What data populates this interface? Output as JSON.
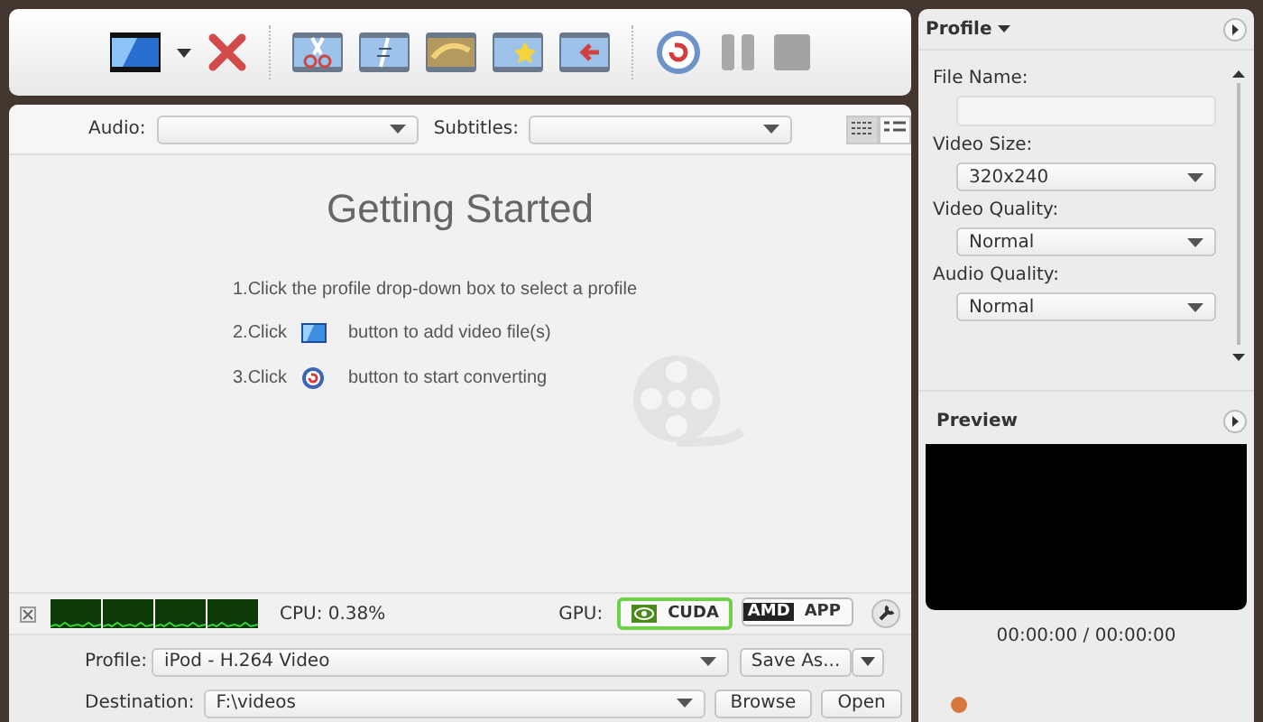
{
  "toolbar": {
    "add_dropdown": true,
    "tools": [
      {
        "kind": "add"
      },
      {
        "kind": "remove"
      },
      {
        "kind": "sep"
      },
      {
        "kind": "clip"
      },
      {
        "kind": "merge"
      },
      {
        "kind": "stereo"
      },
      {
        "kind": "effect"
      },
      {
        "kind": "export"
      },
      {
        "kind": "sep"
      }
    ],
    "playback": [
      {
        "kind": "convert",
        "disabled": false
      },
      {
        "kind": "pause",
        "disabled": true
      },
      {
        "kind": "stop",
        "disabled": true
      }
    ]
  },
  "media_bar": {
    "audio_label": "Audio:",
    "subtitles_label": "Subtitles:",
    "view_modes": [
      {
        "kind": "detail",
        "selected": true
      },
      {
        "kind": "list",
        "selected": false
      }
    ]
  },
  "getting_started": {
    "title": "Getting Started",
    "steps": [
      {
        "kind": "text",
        "text": "1.Click the profile drop-down box to select a profile"
      },
      {
        "kind": "add",
        "prefix": "2.Click",
        "text": "button to add video file(s)"
      },
      {
        "kind": "convert",
        "prefix": "3.Click",
        "text": "button to start converting"
      }
    ]
  },
  "status_bar": {
    "cpu": "CPU: 0.38%",
    "gpu_label": "GPU:",
    "gpu_options": [
      {
        "kind": "nvidia",
        "label": "CUDA",
        "selected": true
      },
      {
        "kind": "amd",
        "logo": "AMD",
        "label": "APP",
        "selected": false
      }
    ]
  },
  "output": {
    "profile_label": "Profile:",
    "profile_value": "iPod - H.264 Video",
    "save_as": "Save As...",
    "destination_label": "Destination:",
    "destination_value": "F:\\videos",
    "browse": "Browse",
    "open": "Open"
  },
  "profile_panel": {
    "title": "Profile",
    "fields": [
      {
        "kind": "text",
        "label": "File Name:"
      },
      {
        "kind": "select",
        "label": "Video Size:",
        "value": "320x240"
      },
      {
        "kind": "select",
        "label": "Video Quality:",
        "value": "Normal"
      },
      {
        "kind": "select",
        "label": "Audio Quality:",
        "value": "Normal"
      }
    ]
  },
  "preview": {
    "title": "Preview",
    "time": "00:00:00 / 00:00:00"
  }
}
